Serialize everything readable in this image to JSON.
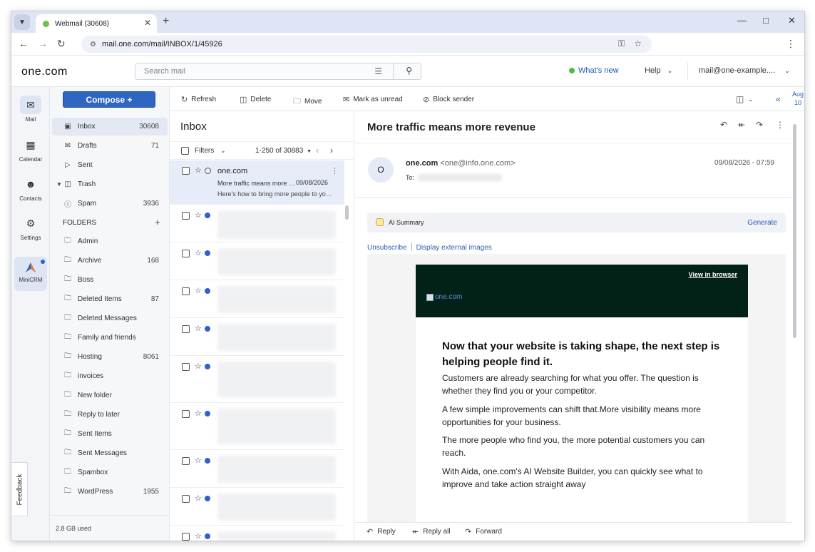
{
  "browser": {
    "tab_title": "Webmail (30608)",
    "url": "mail.one.com/mail/INBOX/1/45926"
  },
  "header": {
    "logo": "one.com",
    "search_placeholder": "Search mail",
    "whats_new": "What's new",
    "help": "Help",
    "account": "mail@one-example...."
  },
  "rail": {
    "mail": "Mail",
    "calendar": "Calendar",
    "contacts": "Contacts",
    "settings": "Settings",
    "minicrm": "MiniCRM",
    "feedback": "Feedback"
  },
  "folders": {
    "compose": "Compose +",
    "system": [
      {
        "label": "Inbox",
        "count": "30608",
        "icon": "inbox-icon"
      },
      {
        "label": "Drafts",
        "count": "71",
        "icon": "drafts-icon"
      },
      {
        "label": "Sent",
        "count": "",
        "icon": "sent-icon"
      },
      {
        "label": "Trash",
        "count": "",
        "icon": "trash-icon"
      },
      {
        "label": "Spam",
        "count": "3936",
        "icon": "spam-icon"
      }
    ],
    "heading": "FOLDERS",
    "custom": [
      {
        "label": "Admin",
        "count": ""
      },
      {
        "label": "Archive",
        "count": "168"
      },
      {
        "label": "Boss",
        "count": ""
      },
      {
        "label": "Deleted Items",
        "count": "87"
      },
      {
        "label": "Deleted Messages",
        "count": ""
      },
      {
        "label": "Family and friends",
        "count": ""
      },
      {
        "label": "Hosting",
        "count": "8061"
      },
      {
        "label": "invoices",
        "count": ""
      },
      {
        "label": "New folder",
        "count": ""
      },
      {
        "label": "Reply to later",
        "count": ""
      },
      {
        "label": "Sent Items",
        "count": ""
      },
      {
        "label": "Sent Messages",
        "count": ""
      },
      {
        "label": "Spambox",
        "count": ""
      },
      {
        "label": "WordPress",
        "count": "1955"
      }
    ],
    "storage": "2.8 GB used"
  },
  "toolbar": {
    "refresh": "Refresh",
    "delete": "Delete",
    "move": "Move",
    "mark_unread": "Mark as unread",
    "block_sender": "Block sender",
    "date_month": "Aug",
    "date_day": "10"
  },
  "list": {
    "title": "Inbox",
    "filters": "Filters",
    "range": "1-250 of 30883",
    "first_row": {
      "sender": "one.com",
      "subject": "More traffic means more revenue",
      "date": "09/08/2026",
      "preview": "Here's how to bring more people to your website"
    }
  },
  "message": {
    "subject": "More traffic means more revenue",
    "avatar_letter": "O",
    "from_name": "one.com",
    "from_addr": "<one@info.one.com>",
    "to_label": "To:",
    "date": "09/08/2026 - 07:59",
    "ai_summary": "AI Summary",
    "generate": "Generate",
    "unsubscribe": "Unsubscribe",
    "display_images": "Display external images",
    "view_in_browser": "View in browser",
    "logo_alt": "one.com",
    "heading": "Now that your website is taking shape, the next step is helping people find it.",
    "para1": "Customers are already searching for what you offer. The question is whether they find you or your competitor.",
    "para2": "A few simple improvements can shift that.More visibility means more opportunities for your business.",
    "para3": "The more people who find you, the more potential customers you can reach.",
    "para4": "With Aida, one.com's AI Website Builder, you can quickly see what to improve and take action straight away",
    "reply": "Reply",
    "reply_all": "Reply all",
    "forward": "Forward"
  },
  "colors": {
    "accent": "#2f66c2",
    "link": "#2a5fb8",
    "unread_dot": "#2a64c8",
    "banner": "#022117",
    "new_dot": "#58b547"
  }
}
